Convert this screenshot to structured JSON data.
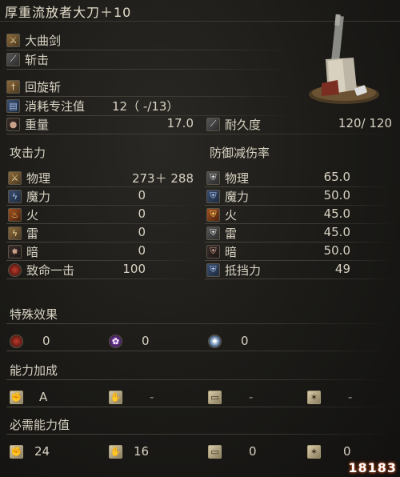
{
  "title": "厚重流放者大刀＋10",
  "weapon": {
    "type": "大曲剑",
    "attack_type": "斩击",
    "skill": "回旋斩",
    "fp_label": "消耗专注值",
    "fp_value": "12（ -/13）",
    "weight_label": "重量",
    "weight_value": "17.0",
    "durability_label": "耐久度",
    "durability_value": "120/ 120"
  },
  "attack": {
    "header": "攻击力",
    "rows": [
      {
        "label": "物理",
        "value": "273＋ 288",
        "icon": "sword-icon"
      },
      {
        "label": "魔力",
        "value": "0",
        "icon": "magic-icon"
      },
      {
        "label": "火",
        "value": "0",
        "icon": "fire-icon"
      },
      {
        "label": "雷",
        "value": "0",
        "icon": "lightning-icon"
      },
      {
        "label": "暗",
        "value": "0",
        "icon": "dark-icon"
      },
      {
        "label": "致命一击",
        "value": "100",
        "icon": "critical-icon"
      }
    ]
  },
  "defense": {
    "header": "防御减伤率",
    "rows": [
      {
        "label": "物理",
        "value": "65.0",
        "icon": "shield-physical-icon"
      },
      {
        "label": "魔力",
        "value": "50.0",
        "icon": "shield-magic-icon"
      },
      {
        "label": "火",
        "value": "45.0",
        "icon": "shield-fire-icon"
      },
      {
        "label": "雷",
        "value": "45.0",
        "icon": "shield-lightning-icon"
      },
      {
        "label": "暗",
        "value": "50.0",
        "icon": "shield-dark-icon"
      },
      {
        "label": "抵挡力",
        "value": "49",
        "icon": "guard-icon"
      }
    ]
  },
  "effects": {
    "header": "特殊效果",
    "items": [
      {
        "value": "0",
        "icon": "bleed-icon"
      },
      {
        "value": "0",
        "icon": "poison-icon"
      },
      {
        "value": "0",
        "icon": "frost-icon"
      }
    ]
  },
  "scaling": {
    "header": "能力加成",
    "items": [
      {
        "value": "A",
        "icon": "strength-icon"
      },
      {
        "value": "-",
        "icon": "dexterity-icon"
      },
      {
        "value": "-",
        "icon": "intelligence-icon"
      },
      {
        "value": "-",
        "icon": "faith-icon"
      }
    ]
  },
  "requirements": {
    "header": "必需能力值",
    "items": [
      {
        "value": "24",
        "icon": "strength-icon"
      },
      {
        "value": "16",
        "icon": "dexterity-icon"
      },
      {
        "value": "0",
        "icon": "intelligence-icon"
      },
      {
        "value": "0",
        "icon": "faith-icon"
      }
    ]
  },
  "watermark": "18183"
}
